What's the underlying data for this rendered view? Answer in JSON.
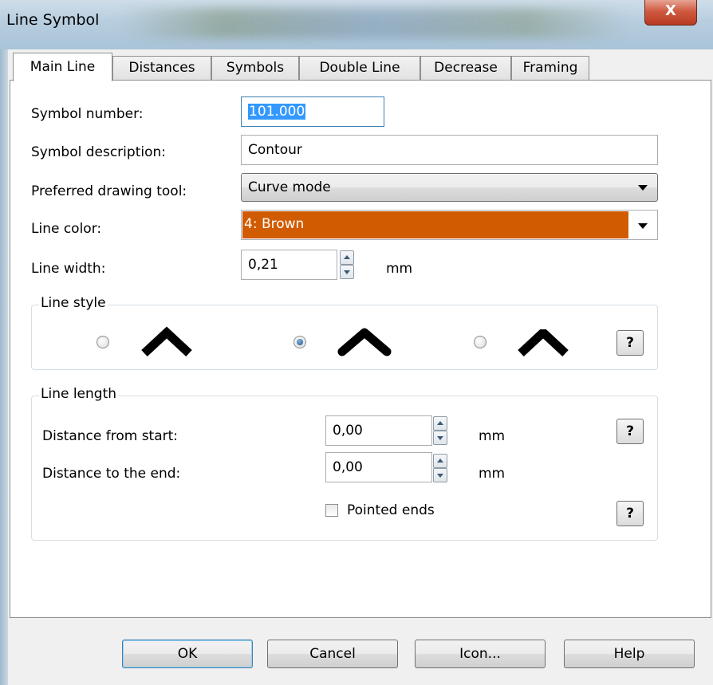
{
  "window": {
    "title": "Line Symbol",
    "close_label": "X"
  },
  "tabs": [
    {
      "label": "Main Line",
      "active": true
    },
    {
      "label": "Distances"
    },
    {
      "label": "Symbols"
    },
    {
      "label": "Double Line"
    },
    {
      "label": "Decrease"
    },
    {
      "label": "Framing"
    }
  ],
  "form": {
    "symbol_number_label": "Symbol number:",
    "symbol_number_value": "101.000",
    "symbol_description_label": "Symbol description:",
    "symbol_description_value": "Contour",
    "drawing_tool_label": "Preferred drawing tool:",
    "drawing_tool_value": "Curve mode",
    "line_color_label": "Line color:",
    "line_color_value": "4: Brown",
    "line_color_hex": "#d15b00",
    "line_width_label": "Line width:",
    "line_width_value": "0,21",
    "line_width_unit": "mm"
  },
  "line_style": {
    "title": "Line style",
    "options": [
      {
        "name": "miter",
        "selected": false
      },
      {
        "name": "round",
        "selected": true
      },
      {
        "name": "bevel",
        "selected": false
      }
    ],
    "help_label": "?"
  },
  "line_length": {
    "title": "Line length",
    "distance_start_label": "Distance from start:",
    "distance_start_value": "0,00",
    "distance_start_unit": "mm",
    "distance_end_label": "Distance to the end:",
    "distance_end_value": "0,00",
    "distance_end_unit": "mm",
    "pointed_ends_label": "Pointed ends",
    "pointed_ends_checked": false,
    "help_label": "?"
  },
  "buttons": {
    "ok": "OK",
    "cancel": "Cancel",
    "icon": "Icon...",
    "help": "Help"
  }
}
